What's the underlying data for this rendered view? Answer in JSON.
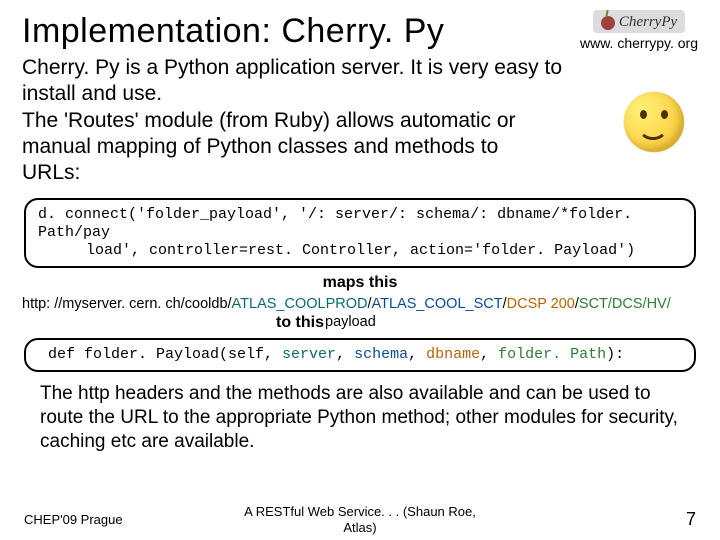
{
  "title": "Implementation: Cherry. Py",
  "logo": {
    "text": "CherryPy",
    "url": "www. cherrypy. org"
  },
  "intro_line1": "Cherry. Py is a Python application server. It is very easy to install and use.",
  "intro_line2": "The 'Routes' module (from Ruby) allows automatic or manual mapping of Python classes and methods to URLs:",
  "code1": {
    "l1": "d. connect('folder_payload', '/: server/: schema/: dbname/*folder. Path/pay",
    "l2": "load', controller=rest. Controller, action='folder. Payload')"
  },
  "maps_label": "maps this",
  "url": {
    "prefix": "http: //myserver. cern. ch/cooldb/",
    "p1": "ATLAS_COOLPROD",
    "p2": "ATLAS_COOL_SCT",
    "p3": "DCSP 200",
    "p4": "SCT/DCS/HV/",
    "slash": "/"
  },
  "tothis": {
    "label": "to this",
    "overlap": "payload"
  },
  "sig": {
    "pre": "def folder. Payload(self, ",
    "a1": "server",
    "a2": "schema",
    "a3": "dbname",
    "a4": "folder. Path",
    "post": "):",
    "comma": ", "
  },
  "body2": "The http headers and the methods are also available and can be used to route the URL to the appropriate Python method; other modules for security, caching etc are available.",
  "footer": {
    "left": "CHEP'09 Prague",
    "mid1": "A RESTful Web Service. . . (Shaun Roe,",
    "mid2": "Atlas)",
    "page": "7"
  }
}
